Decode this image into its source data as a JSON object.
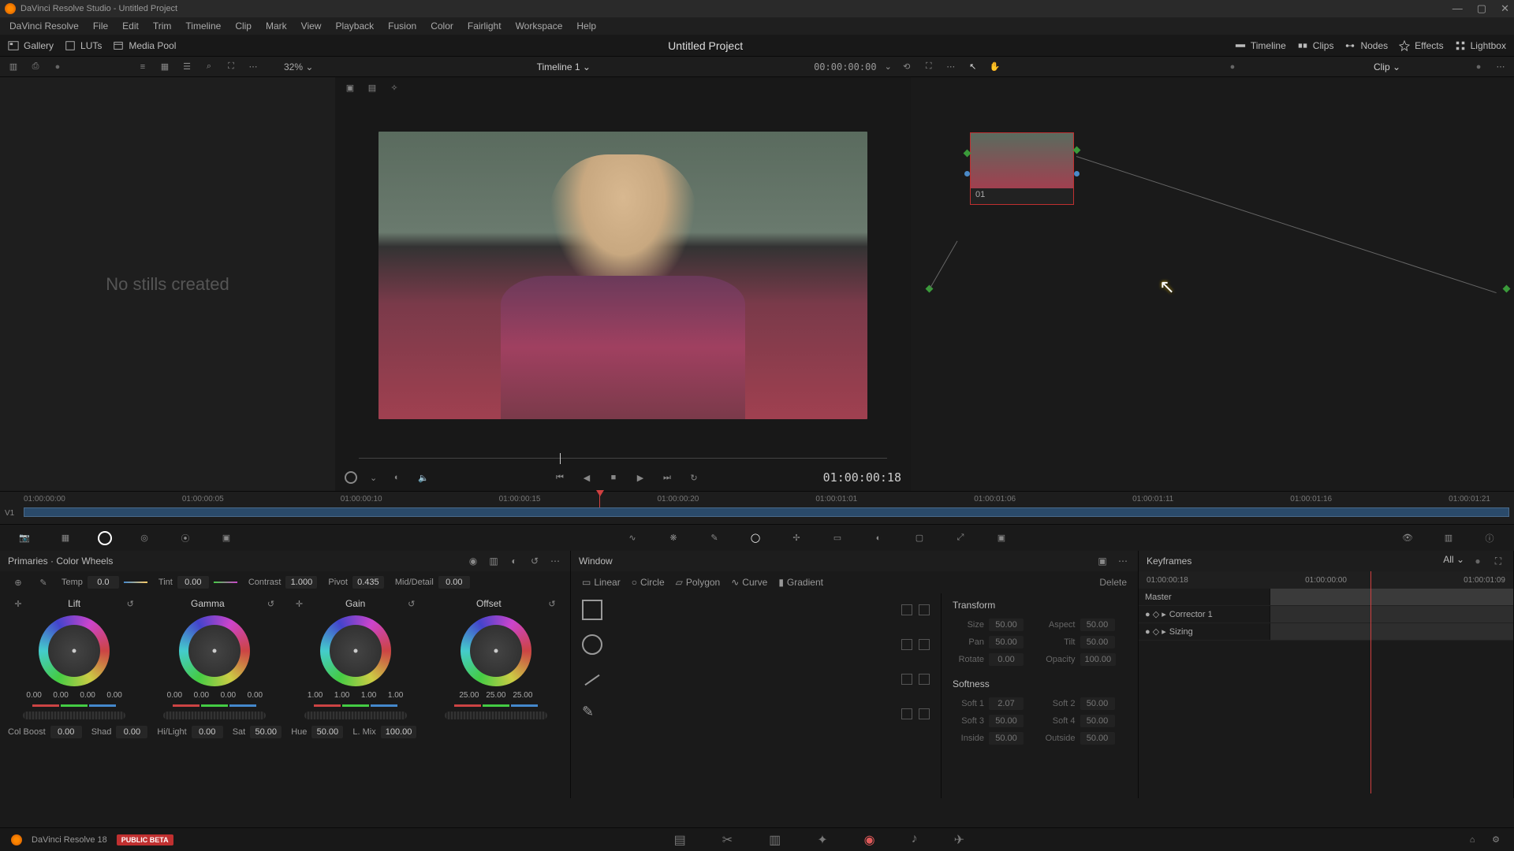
{
  "app": {
    "title": "DaVinci Resolve Studio - Untitled Project",
    "name": "DaVinci Resolve"
  },
  "menu": [
    "File",
    "Edit",
    "Trim",
    "Timeline",
    "Clip",
    "Mark",
    "View",
    "Playback",
    "Fusion",
    "Color",
    "Fairlight",
    "Workspace",
    "Help"
  ],
  "top_toolbar": {
    "left": [
      {
        "name": "gallery",
        "label": "Gallery"
      },
      {
        "name": "luts",
        "label": "LUTs"
      },
      {
        "name": "mediapool",
        "label": "Media Pool"
      }
    ],
    "project_title": "Untitled Project",
    "right": [
      {
        "name": "timeline",
        "label": "Timeline"
      },
      {
        "name": "clips",
        "label": "Clips"
      },
      {
        "name": "nodes",
        "label": "Nodes"
      },
      {
        "name": "effects",
        "label": "Effects"
      },
      {
        "name": "lightbox",
        "label": "Lightbox"
      }
    ]
  },
  "sub_toolbar": {
    "zoom": "32%",
    "timeline_name": "Timeline 1",
    "timecode": "00:00:00:00",
    "clip_mode": "Clip"
  },
  "gallery": {
    "empty_text": "No stills created"
  },
  "viewer": {
    "timecode": "01:00:00:18"
  },
  "node_panel": {
    "node_label": "01"
  },
  "timeline": {
    "track_label": "V1",
    "ticks": [
      "01:00:00:00",
      "01:00:00:05",
      "01:00:00:10",
      "01:00:00:15",
      "01:00:00:20",
      "01:00:01:01",
      "01:00:01:06",
      "01:00:01:11",
      "01:00:01:16",
      "01:00:01:21"
    ]
  },
  "primaries": {
    "title": "Primaries · Color Wheels",
    "adjustments": {
      "temp": {
        "label": "Temp",
        "value": "0.0"
      },
      "tint": {
        "label": "Tint",
        "value": "0.00"
      },
      "contrast": {
        "label": "Contrast",
        "value": "1.000"
      },
      "pivot": {
        "label": "Pivot",
        "value": "0.435"
      },
      "middetail": {
        "label": "Mid/Detail",
        "value": "0.00"
      }
    },
    "wheels": {
      "lift": {
        "name": "Lift",
        "vals": [
          "0.00",
          "0.00",
          "0.00",
          "0.00"
        ]
      },
      "gamma": {
        "name": "Gamma",
        "vals": [
          "0.00",
          "0.00",
          "0.00",
          "0.00"
        ]
      },
      "gain": {
        "name": "Gain",
        "vals": [
          "1.00",
          "1.00",
          "1.00",
          "1.00"
        ]
      },
      "offset": {
        "name": "Offset",
        "vals": [
          "25.00",
          "25.00",
          "25.00"
        ]
      }
    },
    "bottom": {
      "colboost": {
        "label": "Col Boost",
        "value": "0.00"
      },
      "shad": {
        "label": "Shad",
        "value": "0.00"
      },
      "hilight": {
        "label": "Hi/Light",
        "value": "0.00"
      },
      "sat": {
        "label": "Sat",
        "value": "50.00"
      },
      "hue": {
        "label": "Hue",
        "value": "50.00"
      },
      "lmix": {
        "label": "L. Mix",
        "value": "100.00"
      }
    }
  },
  "window": {
    "title": "Window",
    "tabs": {
      "linear": "Linear",
      "circle": "Circle",
      "polygon": "Polygon",
      "curve": "Curve",
      "gradient": "Gradient",
      "delete": "Delete"
    },
    "transform": {
      "title": "Transform",
      "size": {
        "label": "Size",
        "value": "50.00"
      },
      "aspect": {
        "label": "Aspect",
        "value": "50.00"
      },
      "pan": {
        "label": "Pan",
        "value": "50.00"
      },
      "tilt": {
        "label": "Tilt",
        "value": "50.00"
      },
      "rotate": {
        "label": "Rotate",
        "value": "0.00"
      },
      "opacity": {
        "label": "Opacity",
        "value": "100.00"
      }
    },
    "softness": {
      "title": "Softness",
      "soft1": {
        "label": "Soft 1",
        "value": "2.07"
      },
      "soft2": {
        "label": "Soft 2",
        "value": "50.00"
      },
      "soft3": {
        "label": "Soft 3",
        "value": "50.00"
      },
      "soft4": {
        "label": "Soft 4",
        "value": "50.00"
      },
      "inside": {
        "label": "Inside",
        "value": "50.00"
      },
      "outside": {
        "label": "Outside",
        "value": "50.00"
      }
    }
  },
  "keyframes": {
    "title": "Keyframes",
    "mode": "All",
    "ruler": [
      "01:00:00:18",
      "01:00:00:00",
      "01:00:01:09"
    ],
    "rows": {
      "master": "Master",
      "corrector": "Corrector 1",
      "sizing": "Sizing"
    }
  },
  "footer": {
    "version": "DaVinci Resolve 18",
    "badge": "PUBLIC BETA"
  }
}
